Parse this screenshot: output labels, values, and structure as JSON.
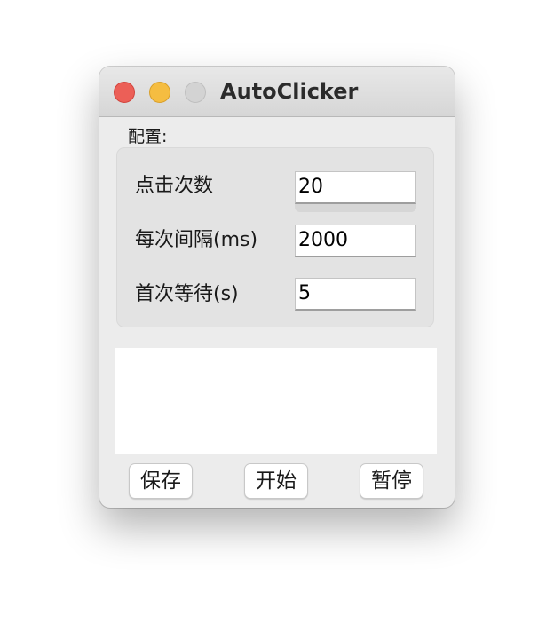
{
  "window": {
    "title": "AutoClicker",
    "traffic_lights": {
      "close_color": "#ec5f57",
      "minimize_color": "#f5bd41",
      "zoom_color": "#d3d3d3"
    }
  },
  "config": {
    "section_label": "配置:",
    "rows": [
      {
        "label": "点击次数",
        "value": "20"
      },
      {
        "label": "每次间隔(ms)",
        "value": "2000"
      },
      {
        "label": "首次等待(s)",
        "value": "5"
      }
    ]
  },
  "log": {
    "text": ""
  },
  "buttons": {
    "save": "保存",
    "start": "开始",
    "pause": "暂停"
  }
}
